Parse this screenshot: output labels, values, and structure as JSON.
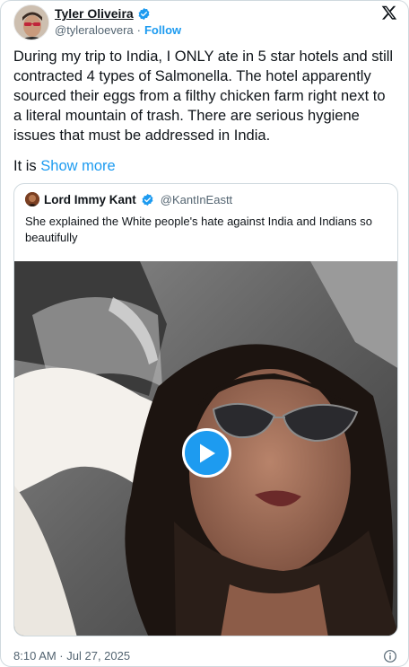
{
  "tweet": {
    "author_name": "Tyler Oliveira",
    "author_handle": "@tyleraloevera",
    "separator": "·",
    "follow_label": "Follow",
    "text": "During my trip to India, I ONLY ate in 5 star hotels and still contracted 4 types of Salmonella. The hotel apparently sourced their eggs from a filthy chicken farm right next to a literal mountain of trash. There are serious hygiene issues that must be addressed in India.",
    "truncated_text": "It is",
    "show_more_label": "Show more",
    "timestamp": "8:10 AM · Jul 27, 2025"
  },
  "quote": {
    "author_name": "Lord Immy Kant",
    "author_handle": "@KantInEastt",
    "text": "She explained the White people's hate against India and Indians so beautifully"
  },
  "icons": {
    "brand": "x-logo-icon",
    "verified": "verified-badge-icon",
    "play": "play-icon",
    "info": "info-icon"
  },
  "colors": {
    "accent": "#1d9bf0",
    "text": "#0f1419",
    "secondary": "#536471",
    "border": "#cfd9de"
  }
}
